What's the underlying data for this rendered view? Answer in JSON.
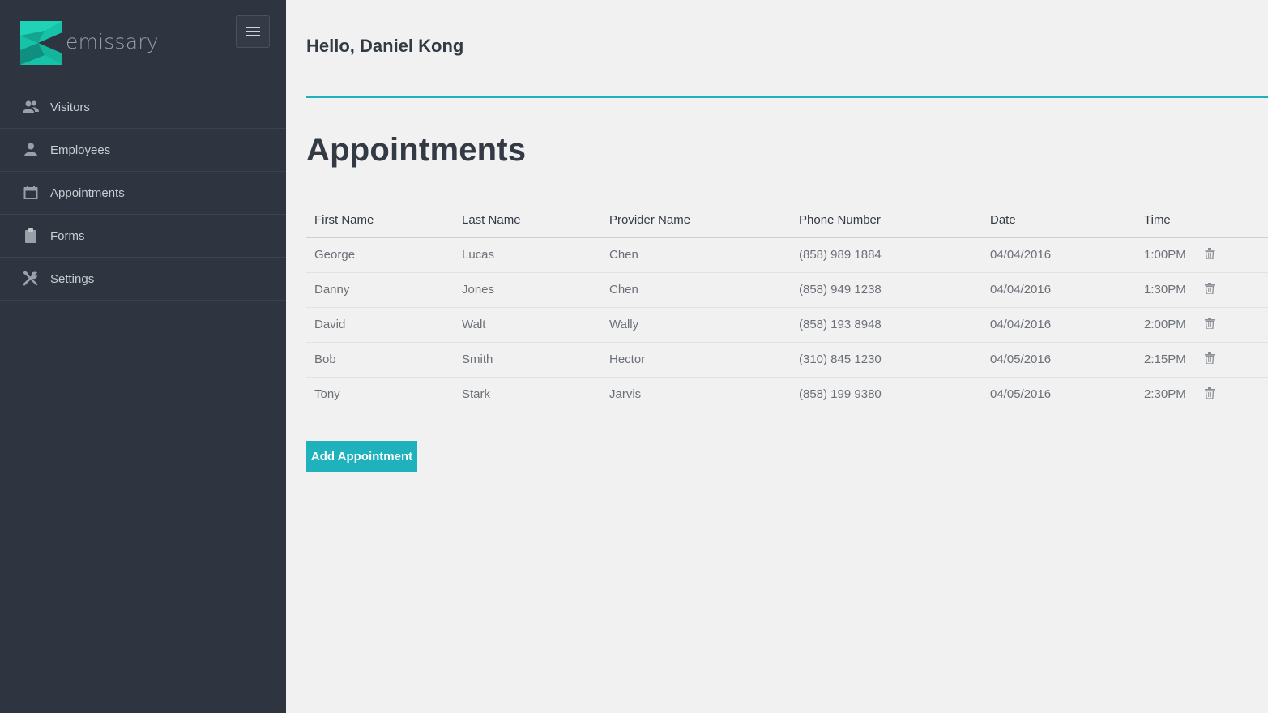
{
  "app": {
    "brand": "emissary",
    "colors": {
      "sidebar": "#2e3440",
      "accent": "#1fb2bd",
      "background": "#f1f1f1"
    }
  },
  "sidebar": {
    "menu_toggle_icon": "hamburger-menu-icon",
    "items": [
      {
        "label": "Visitors",
        "icon": "users-icon"
      },
      {
        "label": "Employees",
        "icon": "user-icon"
      },
      {
        "label": "Appointments",
        "icon": "calendar-icon"
      },
      {
        "label": "Forms",
        "icon": "clipboard-icon"
      },
      {
        "label": "Settings",
        "icon": "tools-icon"
      }
    ]
  },
  "header": {
    "greeting": "Hello, Daniel Kong"
  },
  "main": {
    "title": "Appointments",
    "table": {
      "columns": [
        "First Name",
        "Last Name",
        "Provider Name",
        "Phone Number",
        "Date",
        "Time"
      ],
      "rows": [
        [
          "George",
          "Lucas",
          "Chen",
          "(858) 989 1884",
          "04/04/2016",
          "1:00PM"
        ],
        [
          "Danny",
          "Jones",
          "Chen",
          "(858) 949 1238",
          "04/04/2016",
          "1:30PM"
        ],
        [
          "David",
          "Walt",
          "Wally",
          "(858) 193 8948",
          "04/04/2016",
          "2:00PM"
        ],
        [
          "Bob",
          "Smith",
          "Hector",
          "(310) 845 1230",
          "04/05/2016",
          "2:15PM"
        ],
        [
          "Tony",
          "Stark",
          "Jarvis",
          "(858) 199 9380",
          "04/05/2016",
          "2:30PM"
        ]
      ],
      "row_action_icon": "trash-icon"
    },
    "add_button_label": "Add Appointment"
  }
}
